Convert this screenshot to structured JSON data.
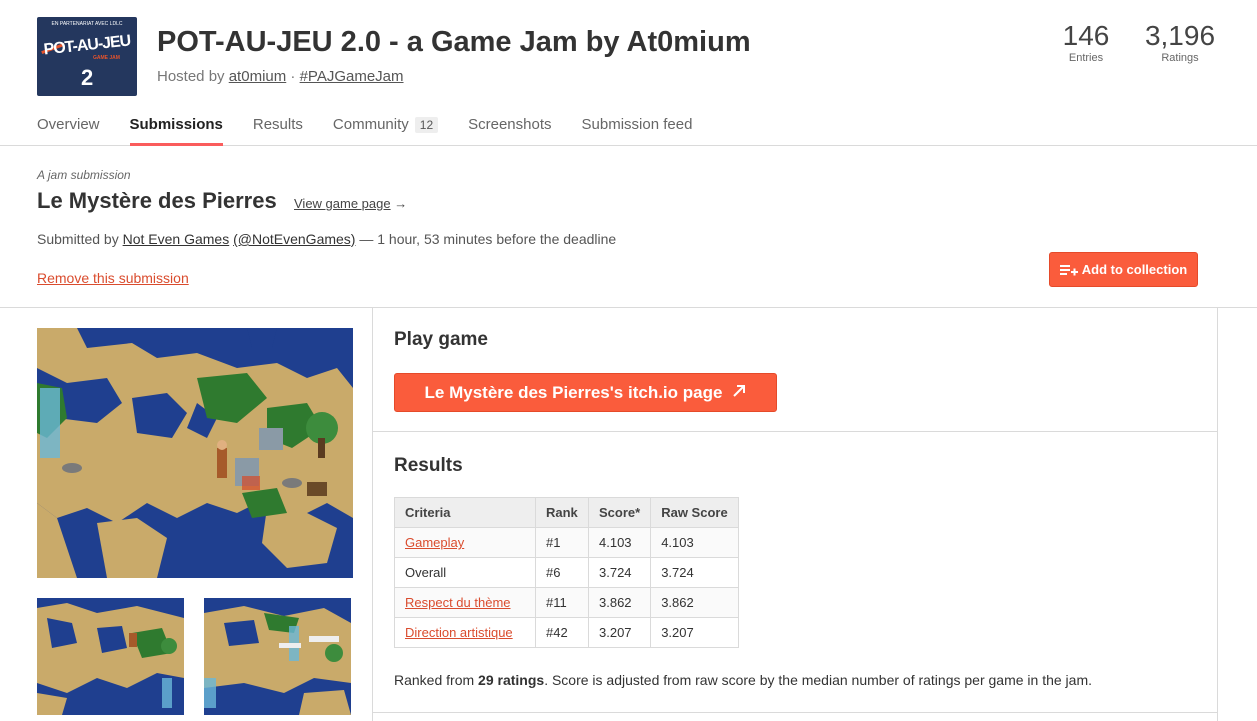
{
  "jam": {
    "logo": {
      "top_text": "EN PARTENARIAT AVEC  LDLC",
      "main_text": "POT-AU-JEU",
      "sub_text": "GAME JAM",
      "number": "2"
    },
    "title": "POT-AU-JEU 2.0 - a Game Jam by At0mium",
    "hosted_prefix": "Hosted by ",
    "host": "at0mium",
    "separator": " · ",
    "hashtag": "#PAJGameJam",
    "stats": {
      "entries_value": "146",
      "entries_label": "Entries",
      "ratings_value": "3,196",
      "ratings_label": "Ratings"
    }
  },
  "nav": {
    "tabs": [
      {
        "label": "Overview"
      },
      {
        "label": "Submissions",
        "active": true
      },
      {
        "label": "Results"
      },
      {
        "label": "Community",
        "badge": "12"
      },
      {
        "label": "Screenshots"
      },
      {
        "label": "Submission feed"
      }
    ]
  },
  "submission": {
    "kicker": "A jam submission",
    "game_title": "Le Mystère des Pierres",
    "view_link": "View game page",
    "view_arrow": "→",
    "byline_prefix": "Submitted by ",
    "author": "Not Even Games",
    "handle": "(@NotEvenGames)",
    "byline_suffix": " — 1 hour, 53 minutes before the deadline",
    "remove_label": "Remove this submission",
    "add_collection_label": "Add to collection",
    "add_collection_icon": "add-to-list-icon"
  },
  "play": {
    "heading": "Play game",
    "button_label": "Le Mystère des Pierres's itch.io page",
    "button_icon": "external-arrow-icon"
  },
  "results": {
    "heading": "Results",
    "columns": [
      "Criteria",
      "Rank",
      "Score*",
      "Raw Score"
    ],
    "rows": [
      {
        "criteria": "Gameplay",
        "rank": "#1",
        "score": "4.103",
        "raw": "4.103",
        "link": true
      },
      {
        "criteria": "Overall",
        "rank": "#6",
        "score": "3.724",
        "raw": "3.724",
        "link": false
      },
      {
        "criteria": "Respect du thème",
        "rank": "#11",
        "score": "3.862",
        "raw": "3.862",
        "link": true
      },
      {
        "criteria": "Direction artistique",
        "rank": "#42",
        "score": "3.207",
        "raw": "3.207",
        "link": true
      }
    ],
    "note_prefix": "Ranked from ",
    "note_bold": "29 ratings",
    "note_suffix": ". Score is adjusted from raw score by the median number of ratings per game in the jam."
  },
  "colors": {
    "accent": "#fa5c3c",
    "link_red": "#da4c2e",
    "water": "#1f3f8f",
    "sand": "#c9aa6a",
    "grass": "#2f7a2f"
  }
}
